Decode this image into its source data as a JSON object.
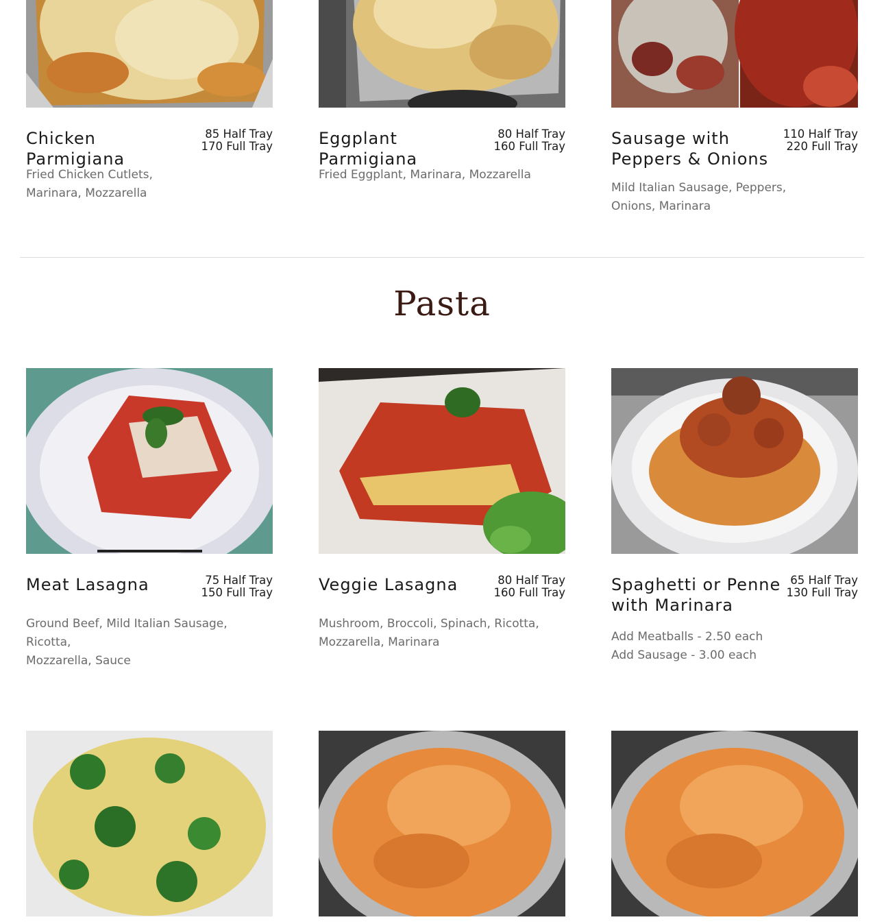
{
  "entrees": {
    "items": [
      {
        "name": "Chicken Parmigiana",
        "price": "85 Half Tray 170 Full Tray",
        "desc": [
          "Fried Chicken Cutlets,",
          "Marinara, Mozzarella"
        ]
      },
      {
        "name": "Eggplant Parmigiana",
        "price": "80 Half Tray 160 Full Tray",
        "desc": [
          "Fried Eggplant, Marinara, Mozzarella"
        ]
      },
      {
        "name": "Sausage with Peppers & Onions",
        "price": "110 Half Tray 220 Full Tray",
        "desc": [
          "Mild Italian Sausage, Peppers,",
          "Onions, Marinara"
        ]
      }
    ]
  },
  "pasta": {
    "title": "Pasta",
    "items": [
      {
        "name": "Meat Lasagna",
        "price": "75 Half Tray 150 Full Tray",
        "desc": [
          "Ground Beef, Mild Italian Sausage, Ricotta,",
          "Mozzarella, Sauce"
        ]
      },
      {
        "name": "Veggie Lasagna",
        "price": "80 Half Tray 160 Full Tray",
        "desc": [
          "Mushroom, Broccoli, Spinach, Ricotta,",
          "Mozzarella, Marinara"
        ]
      },
      {
        "name": "Spaghetti or Penne with Marinara",
        "price": "65 Half Tray 130 Full Tray",
        "desc": [
          "Add Meatballs - 2.50 each",
          "Add Sausage - 3.00 each"
        ]
      }
    ]
  },
  "colors": {
    "section_title": "#3a1a12",
    "description": "#6b6b6b",
    "divider": "#dcdcdc"
  }
}
